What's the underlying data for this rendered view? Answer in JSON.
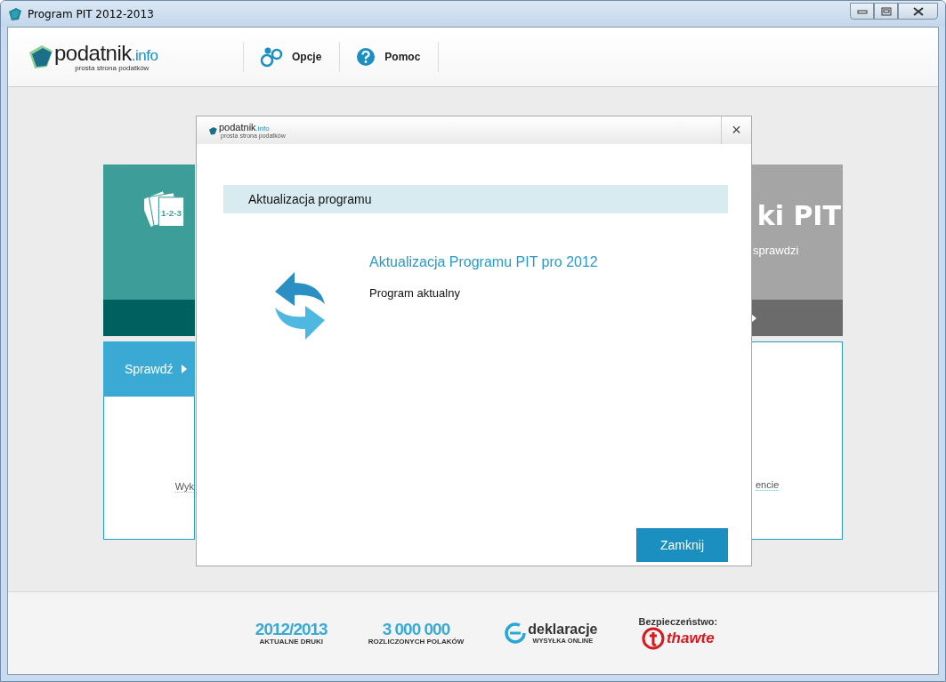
{
  "window": {
    "title": "Program PIT 2012-2013"
  },
  "header": {
    "logo": {
      "name": "podatnik",
      "suffix": ".info",
      "tagline": "prosta strona podatków"
    },
    "menu": [
      {
        "label": "Opcje",
        "kind": "options"
      },
      {
        "label": "Pomoc",
        "kind": "help"
      }
    ]
  },
  "background_cards": [
    {
      "kind": "teal",
      "badge": "1-2-3",
      "button": "Sprawdź",
      "note": "Wyk"
    },
    {
      "kind": "grey",
      "title": "ki PIT",
      "subtitle": "sprawdzi",
      "note": "encie"
    }
  ],
  "dialog": {
    "logo": {
      "name": "podatnik",
      "suffix": ".info",
      "tagline": "prosta strona podatków"
    },
    "close": "×",
    "section": "Aktualizacja programu",
    "heading": "Aktualizacja Programu PIT pro 2012",
    "status": "Program aktualny",
    "button": "Zamknij"
  },
  "footer": {
    "badges": [
      {
        "kind": "stat",
        "big": "2012/2013",
        "small": "AKTUALNE DRUKI"
      },
      {
        "kind": "stat",
        "big": "3 000 000",
        "small": "ROZLICZONYCH POLAKÓW"
      },
      {
        "kind": "edeklaracje",
        "big": "deklaracje",
        "small": "WYSYŁKA ONLINE"
      },
      {
        "kind": "thawte",
        "label": "Bezpieczeństwo:",
        "big": "thawte"
      }
    ]
  }
}
